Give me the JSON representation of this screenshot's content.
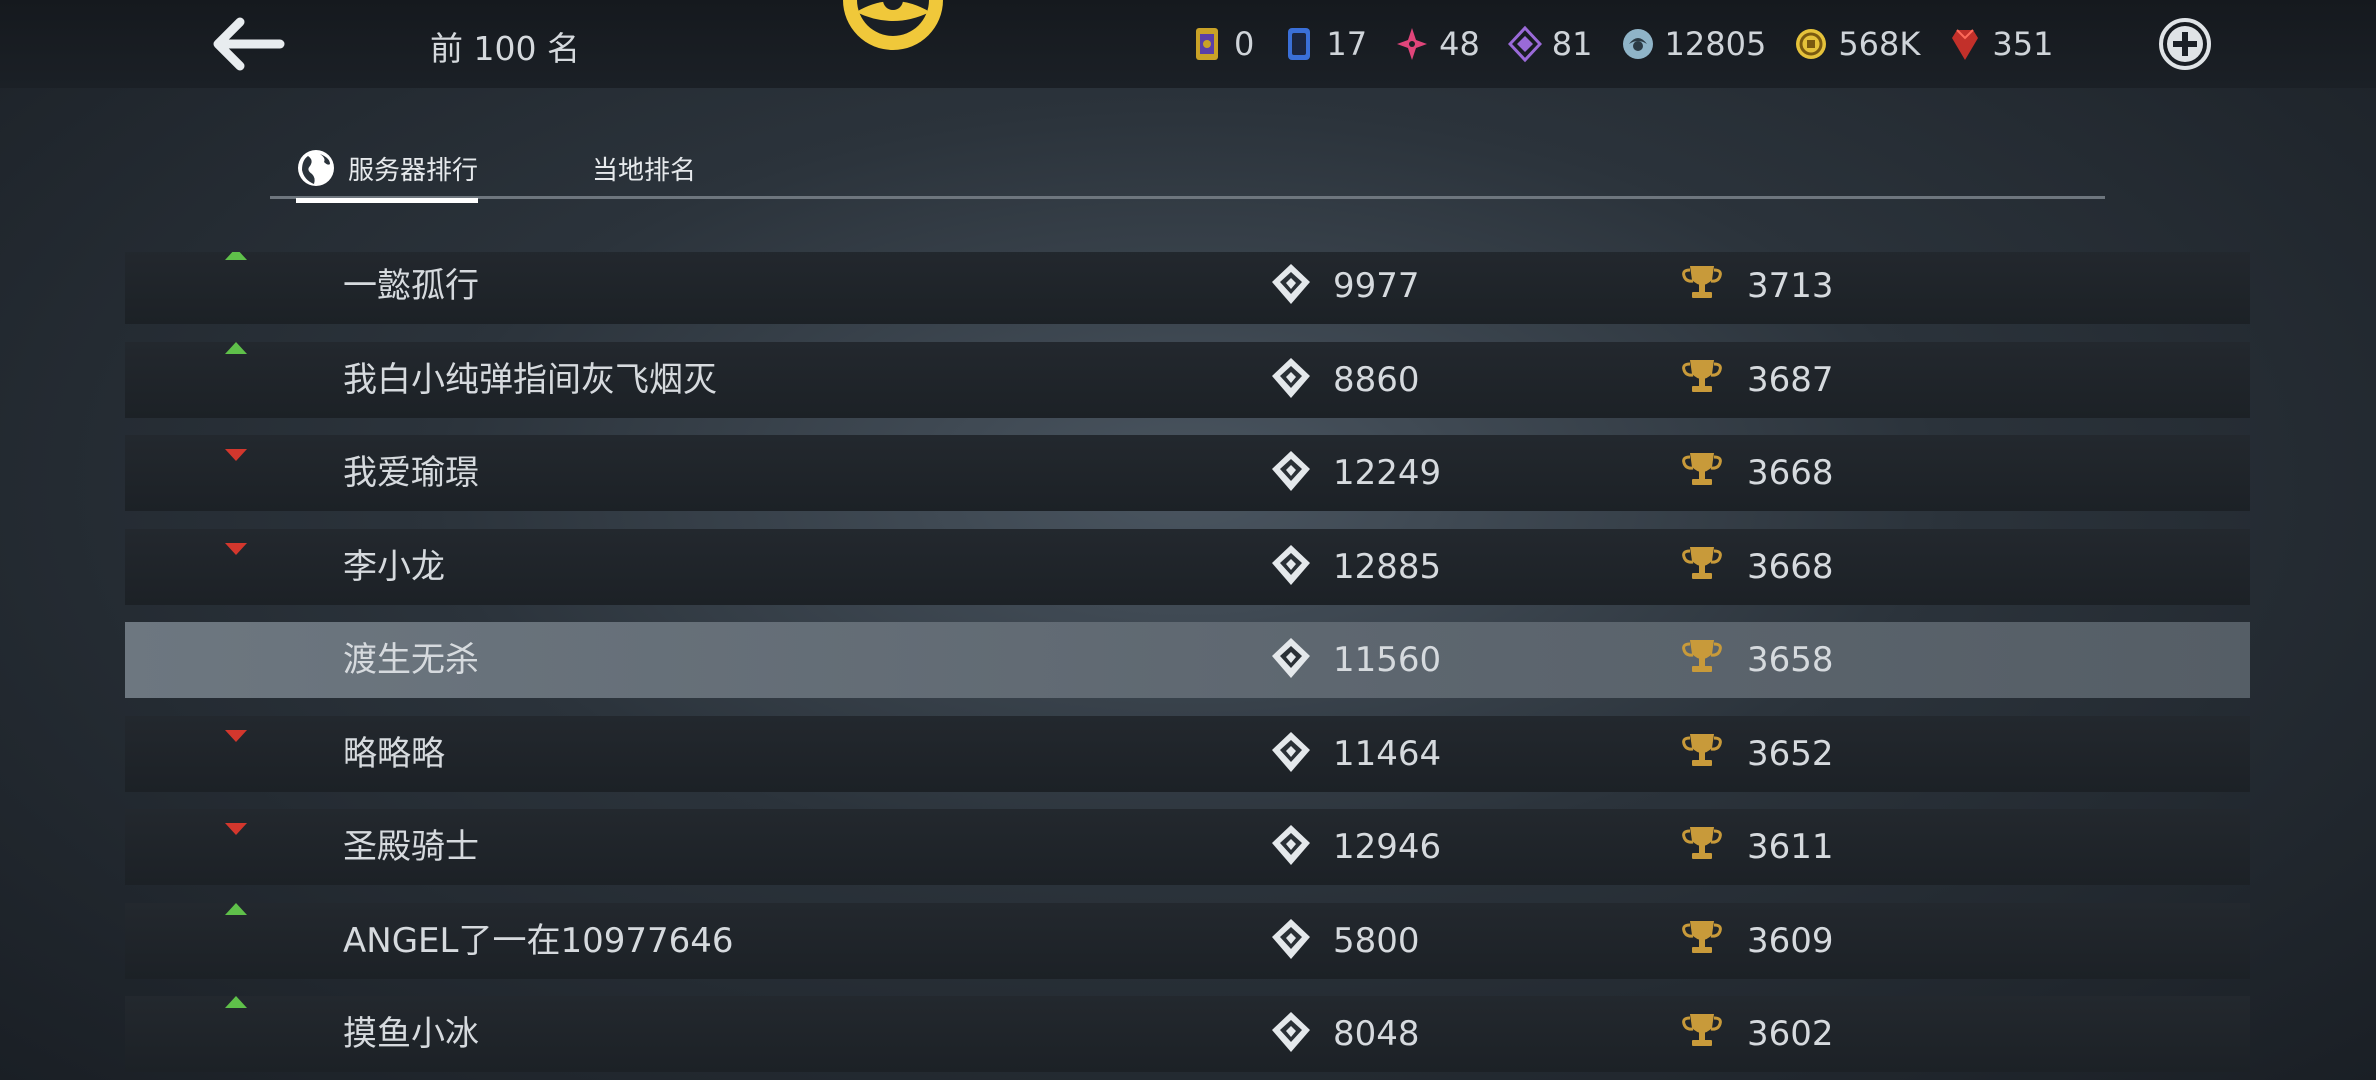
{
  "header": {
    "title": "前 100 名"
  },
  "currencies": [
    {
      "icon": "ticket-icon",
      "value": "0",
      "color": "#c9a227"
    },
    {
      "icon": "card-icon",
      "value": "17",
      "color": "#3a6fd8"
    },
    {
      "icon": "pink-crystal-icon",
      "value": "48",
      "color": "#e0457a"
    },
    {
      "icon": "purple-crystal-icon",
      "value": "81",
      "color": "#9a6ad8"
    },
    {
      "icon": "orb-icon",
      "value": "12805",
      "color": "#8fb4c8"
    },
    {
      "icon": "gold-coin-icon",
      "value": "568K",
      "color": "#e5c23a"
    },
    {
      "icon": "red-gem-icon",
      "value": "351",
      "color": "#c2302a"
    }
  ],
  "tabs": [
    {
      "label": "服务器排行",
      "active": true
    },
    {
      "label": "当地排名",
      "active": false
    }
  ],
  "rows": [
    {
      "trend": "up",
      "name": "一懿孤行",
      "power": "9977",
      "trophies": "3713"
    },
    {
      "trend": "up",
      "name": "我白小纯弹指间灰飞烟灭",
      "power": "8860",
      "trophies": "3687"
    },
    {
      "trend": "down",
      "name": "我爱瑜璟",
      "power": "12249",
      "trophies": "3668"
    },
    {
      "trend": "down",
      "name": "李小龙",
      "power": "12885",
      "trophies": "3668"
    },
    {
      "trend": "none",
      "name": "渡生无杀",
      "power": "11560",
      "trophies": "3658",
      "highlight": true
    },
    {
      "trend": "down",
      "name": "略略略",
      "power": "11464",
      "trophies": "3652"
    },
    {
      "trend": "down",
      "name": "圣殿骑士",
      "power": "12946",
      "trophies": "3611"
    },
    {
      "trend": "up",
      "name": "ANGEL了一在10977646",
      "power": "5800",
      "trophies": "3609"
    },
    {
      "trend": "up",
      "name": "摸鱼小冰",
      "power": "8048",
      "trophies": "3602"
    }
  ],
  "colors": {
    "trend_up": "#5fc04a",
    "trend_down": "#d3372d",
    "trophy": "#c89a3a",
    "emblem": "#f0c83a"
  }
}
